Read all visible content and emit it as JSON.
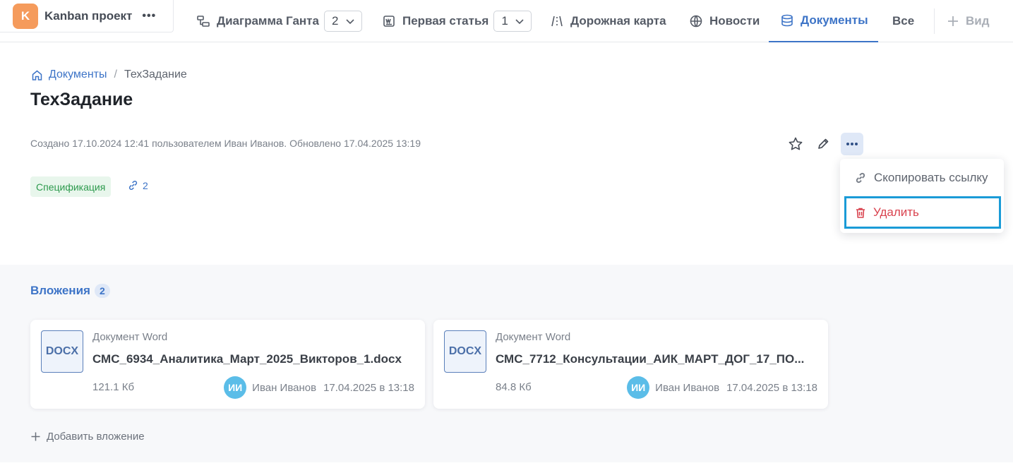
{
  "project": {
    "initial": "K",
    "name": "Kanban проект",
    "menu": "•••"
  },
  "tabs": [
    {
      "label": "Диаграмма Ганта",
      "count": "2",
      "icon": "gantt-icon"
    },
    {
      "label": "Первая статья",
      "count": "1",
      "icon": "article-icon"
    },
    {
      "label": "Дорожная карта",
      "icon": "roadmap-icon"
    },
    {
      "label": "Новости",
      "icon": "globe-icon"
    },
    {
      "label": "Документы",
      "icon": "documents-icon",
      "active": true
    },
    {
      "label": "Все"
    },
    {
      "label": "Вид",
      "icon": "plus-icon"
    }
  ],
  "breadcrumb": {
    "root": "Документы",
    "separator": "/",
    "current": "ТехЗадание"
  },
  "document": {
    "title": "ТехЗадание",
    "meta": "Создано 17.10.2024 12:41 пользователем Иван Иванов. Обновлено 17.04.2025 13:19",
    "tag": "Спецификация",
    "links_count": "2"
  },
  "dropdown": {
    "copy_link": "Скопировать ссылку",
    "delete": "Удалить"
  },
  "attachments": {
    "title": "Вложения",
    "count": "2",
    "items": [
      {
        "ext": "DOCX",
        "type": "Документ Word",
        "name": "СМС_6934_Аналитика_Март_2025_Викторов_1.docx",
        "size": "121.1 Кб",
        "avatar": "ИИ",
        "user": "Иван Иванов",
        "date": "17.04.2025 в 13:18"
      },
      {
        "ext": "DOCX",
        "type": "Документ Word",
        "name": "СМС_7712_Консультации_АИК_МАРТ_ДОГ_17_ПО...",
        "size": "84.8 Кб",
        "avatar": "ИИ",
        "user": "Иван Иванов",
        "date": "17.04.2025 в 13:18"
      }
    ],
    "add_label": "Добавить вложение"
  },
  "colors": {
    "accent": "#3d74c7",
    "danger": "#d9434f",
    "tag_bg": "#e8f6ec",
    "tag_text": "#2d9a4d",
    "project_avatar": "#f59b5c",
    "user_avatar": "#5bbde8"
  }
}
